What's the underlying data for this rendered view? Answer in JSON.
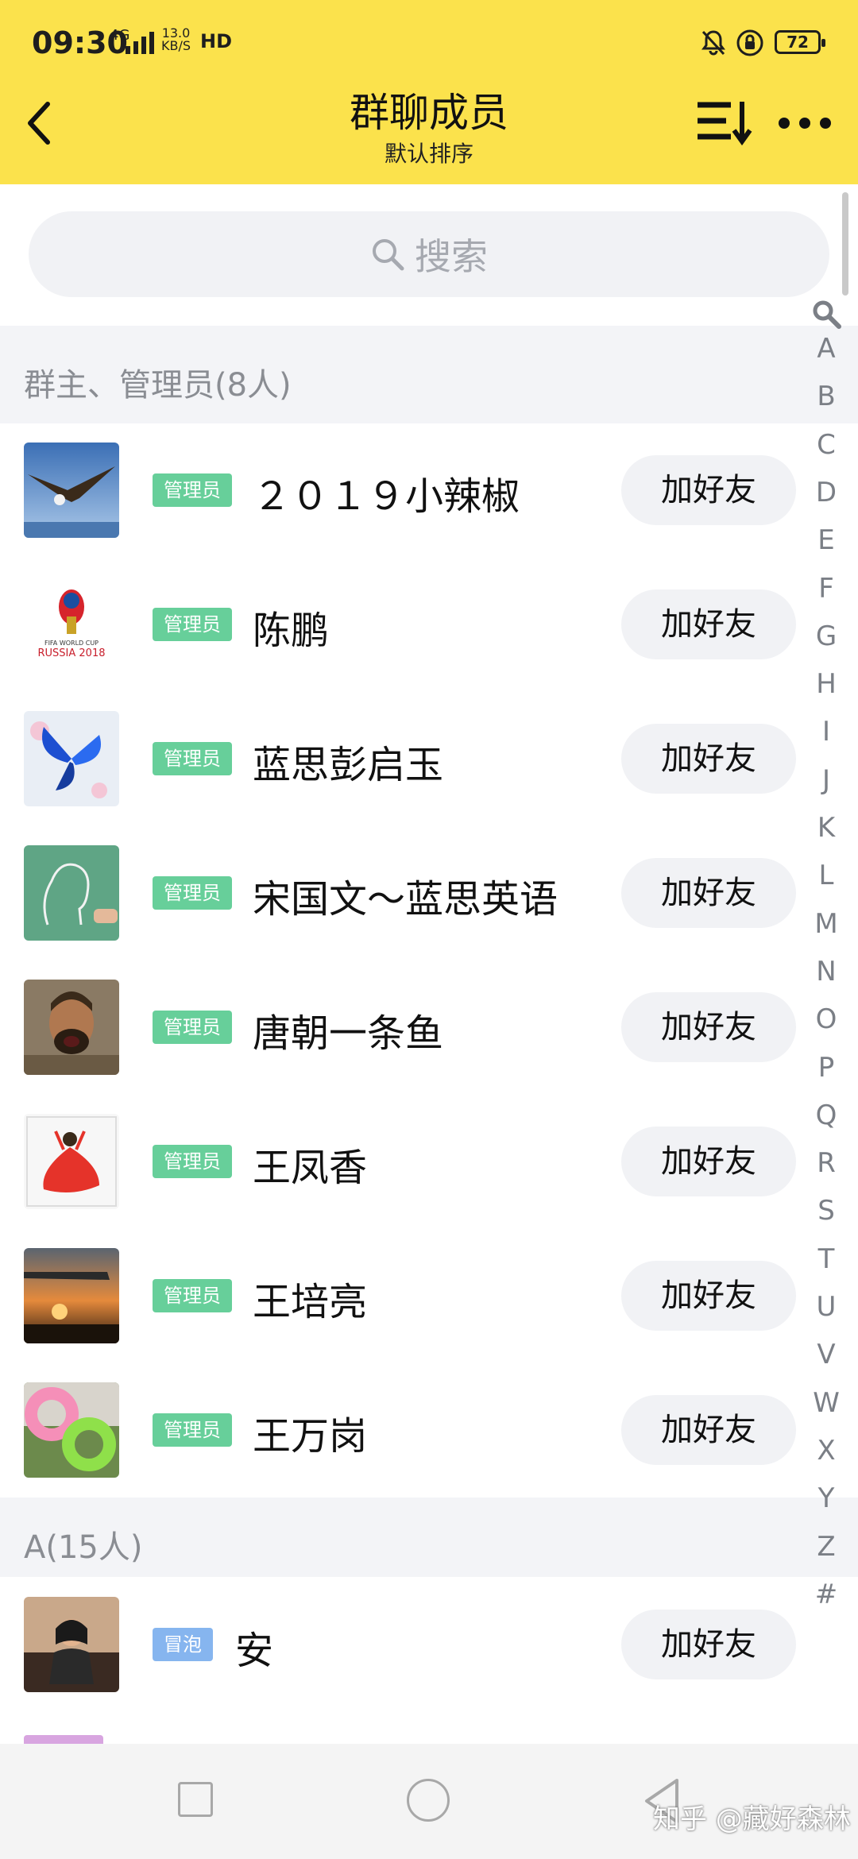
{
  "status_bar": {
    "time": "09:30",
    "network_type": "4G",
    "speed_value": "13.0",
    "speed_unit": "KB/S",
    "hd": "HD",
    "battery": "72"
  },
  "header": {
    "title": "群聊成员",
    "subtitle": "默认排序",
    "back_icon": "chevron-left-icon",
    "sort_icon": "sort-icon",
    "more_icon": "more-icon",
    "background_color": "#fbe24c"
  },
  "search": {
    "placeholder": "搜索"
  },
  "sections": {
    "admins": {
      "label": "群主、管理员(8人)",
      "members": [
        {
          "name": "２０１９小辣椒",
          "role": "管理员",
          "action": "加好友"
        },
        {
          "name": "陈鹏",
          "role": "管理员",
          "action": "加好友"
        },
        {
          "name": "蓝思彭启玉",
          "role": "管理员",
          "action": "加好友"
        },
        {
          "name": "宋国文～蓝思英语",
          "role": "管理员",
          "action": "加好友"
        },
        {
          "name": "唐朝一条鱼",
          "role": "管理员",
          "action": "加好友"
        },
        {
          "name": "王凤香",
          "role": "管理员",
          "action": "加好友"
        },
        {
          "name": "王培亮",
          "role": "管理员",
          "action": "加好友"
        },
        {
          "name": "王万岗",
          "role": "管理员",
          "action": "加好友"
        }
      ]
    },
    "a": {
      "label": "A(15人)",
      "members": [
        {
          "name": "安",
          "role": "冒泡",
          "action": "加好友"
        }
      ]
    }
  },
  "avatar_logo_text": [
    "FIFA WORLD CUP",
    "RUSSIA 2018"
  ],
  "index_bar": {
    "letters": [
      "A",
      "B",
      "C",
      "D",
      "E",
      "F",
      "G",
      "H",
      "I",
      "J",
      "K",
      "L",
      "M",
      "N",
      "O",
      "P",
      "Q",
      "R",
      "S",
      "T",
      "U",
      "V",
      "W",
      "X",
      "Y",
      "Z",
      "#"
    ]
  },
  "colors": {
    "admin_badge": "#67cf9a",
    "bubble_badge": "#86b5ef",
    "section_bg": "#f3f4f7"
  },
  "watermark": "知乎 @藏好森林"
}
